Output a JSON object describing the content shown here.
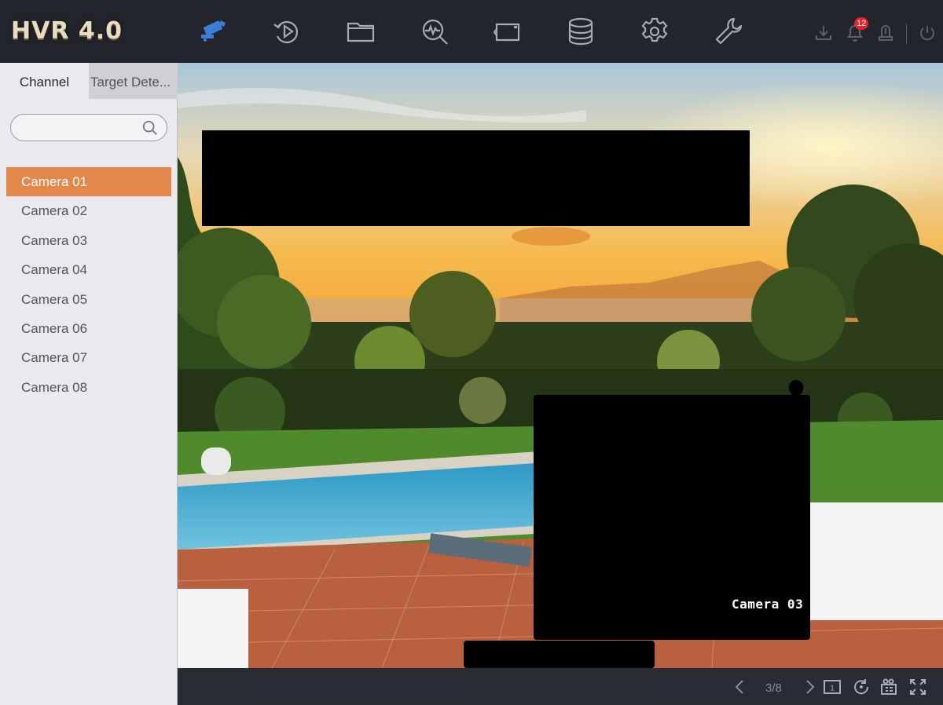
{
  "app": {
    "title": "HVR 4.0"
  },
  "nav": [
    {
      "name": "live-view-icon",
      "active": true
    },
    {
      "name": "playback-icon"
    },
    {
      "name": "file-management-icon"
    },
    {
      "name": "smart-analysis-icon"
    },
    {
      "name": "camera-management-icon"
    },
    {
      "name": "storage-icon"
    },
    {
      "name": "configuration-icon"
    },
    {
      "name": "maintenance-icon"
    }
  ],
  "topright": {
    "download_icon": "download-icon",
    "alarm_icon": "bell-icon",
    "alarm_count": "12",
    "account_icon": "account-icon",
    "power_icon": "power-icon"
  },
  "sidebar": {
    "tabs": [
      {
        "label": "Channel",
        "active": true
      },
      {
        "label": "Target Dete..."
      }
    ],
    "search": {
      "value": "",
      "placeholder": ""
    },
    "cameras": [
      {
        "label": "Camera 01",
        "selected": true
      },
      {
        "label": "Camera 02"
      },
      {
        "label": "Camera 03"
      },
      {
        "label": "Camera 04"
      },
      {
        "label": "Camera 05"
      },
      {
        "label": "Camera 06"
      },
      {
        "label": "Camera 07"
      },
      {
        "label": "Camera 08"
      }
    ]
  },
  "video": {
    "osd_label": "Camera 03"
  },
  "bottombar": {
    "page_indicator": "3/8",
    "layout_number": "1"
  },
  "colors": {
    "accent": "#e2884a",
    "topbar_bg": "#23252d",
    "sidebar_bg": "#e9e9ee",
    "active_icon": "#3b7dd8",
    "icon_gray": "#a9abb2",
    "badge_red": "#e0242b"
  }
}
